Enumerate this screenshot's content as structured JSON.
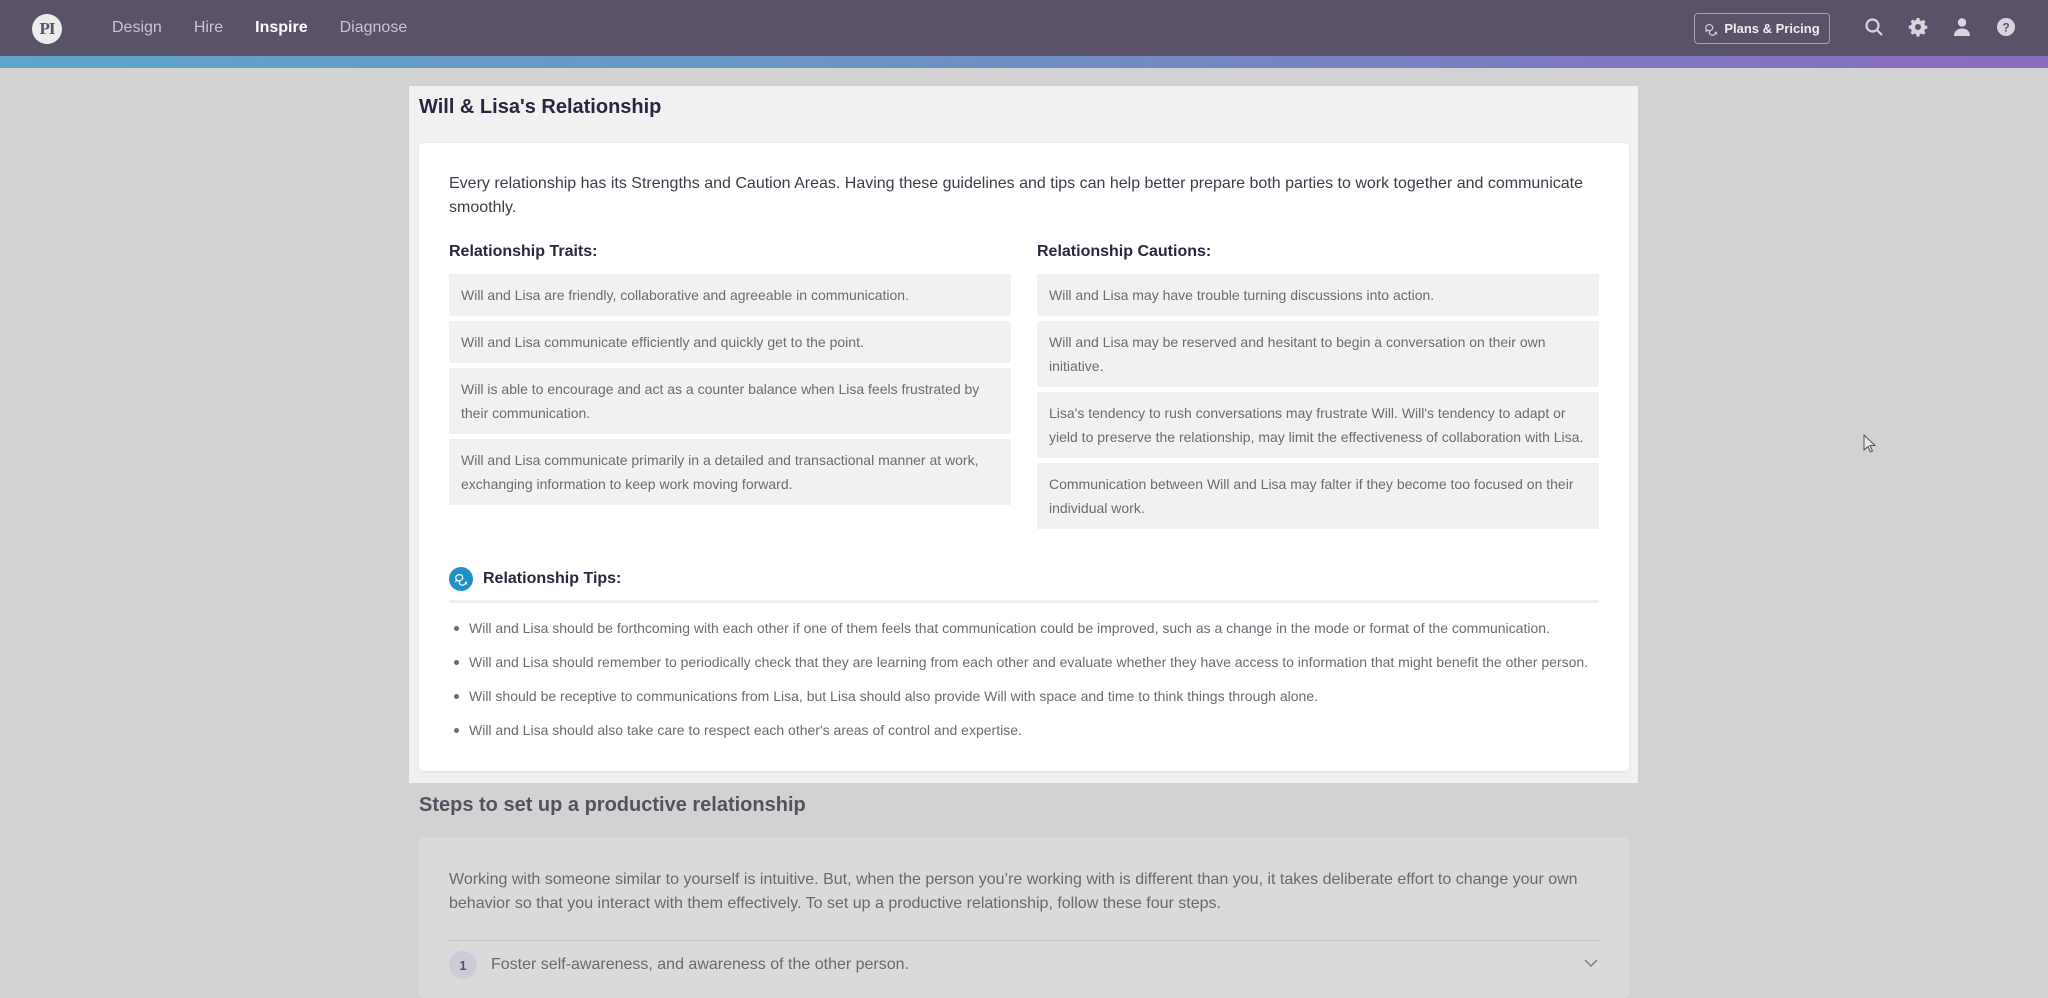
{
  "nav": {
    "logo_text": "PI",
    "links": [
      {
        "label": "Design",
        "active": false
      },
      {
        "label": "Hire",
        "active": false
      },
      {
        "label": "Inspire",
        "active": true
      },
      {
        "label": "Diagnose",
        "active": false
      }
    ],
    "plans_button": "Plans & Pricing",
    "icons": [
      "search-icon",
      "gear-icon",
      "user-icon",
      "help-icon"
    ]
  },
  "colors": {
    "topbar": "#5a5268",
    "accent_gradient_start": "#5fa6c8",
    "accent_gradient_end": "#8b6bbb",
    "tips_icon": "#1e92c8"
  },
  "relationship": {
    "title": "Will & Lisa's Relationship",
    "intro": "Every relationship has its Strengths and Caution Areas. Having these guidelines and tips can help better prepare both parties to work together and communicate smoothly.",
    "traits_heading": "Relationship Traits:",
    "traits": [
      "Will and Lisa are friendly, collaborative and agreeable in communication.",
      "Will and Lisa communicate efficiently and quickly get to the point.",
      "Will is able to encourage and act as a counter balance when Lisa feels frustrated by their communication.",
      "Will and Lisa communicate primarily in a detailed and transactional manner at work, exchanging information to keep work moving forward."
    ],
    "cautions_heading": "Relationship Cautions:",
    "cautions": [
      "Will and Lisa may have trouble turning discussions into action.",
      "Will and Lisa may be reserved and hesitant to begin a conversation on their own initiative.",
      "Lisa's tendency to rush conversations may frustrate Will. Will's tendency to adapt or yield to preserve the relationship, may limit the effectiveness of collaboration with Lisa.",
      "Communication between Will and Lisa may falter if they become too focused on their individual work."
    ],
    "tips_heading": "Relationship Tips:",
    "tips": [
      "Will and Lisa should be forthcoming with each other if one of them feels that communication could be improved, such as a change in the mode or format of the communication.",
      "Will and Lisa should remember to periodically check that they are learning from each other and evaluate whether they have access to information that might benefit the other person.",
      "Will should be receptive to communications from Lisa, but Lisa should also provide Will with space and time to think things through alone.",
      "Will and Lisa should also take care to respect each other's areas of control and expertise."
    ]
  },
  "steps": {
    "title": "Steps to set up a productive relationship",
    "intro": "Working with someone similar to yourself is intuitive. But, when the person you’re working with is different than you, it takes deliberate effort to change your own behavior so that you interact with them effectively. To set up a productive relationship, follow these four steps.",
    "items": [
      {
        "number": "1",
        "label": "Foster self-awareness, and awareness of the other person."
      }
    ]
  }
}
